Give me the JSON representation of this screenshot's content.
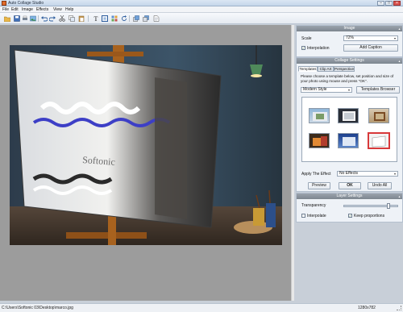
{
  "window": {
    "title": "Auto Collage Studio"
  },
  "menu": [
    "File",
    "Edit",
    "Image",
    "Effects",
    "View",
    "Help"
  ],
  "toolbar_icons": [
    "open-icon",
    "save-icon",
    "print-icon",
    "image-icon",
    "undo-icon",
    "redo-icon",
    "cut-icon",
    "copy-icon",
    "paste-icon",
    "text-icon",
    "border-icon",
    "collage-icon",
    "rotate-icon",
    "bring-forward-icon",
    "send-backward-icon",
    "page-icon"
  ],
  "status": {
    "path": "C:\\Users\\Softonic 03\\Desktop\\marco.jpg",
    "dimensions": "1280x782"
  },
  "image_panel": {
    "header": "Image",
    "scale_label": "Scale",
    "scale_value": "72%",
    "interpolation_label": "Interpolation",
    "interpolation_checked": true,
    "add_caption_label": "Add Caption"
  },
  "collage_panel": {
    "header": "Collage Settings",
    "tabs": [
      "Templates",
      "Clip Art",
      "Perspective"
    ],
    "instructions": "Please choose a template below, set position and size of your photo using mouse and press \"OK\".",
    "style_value": "Modern Style",
    "templates_browser_label": "Templates Browser",
    "apply_effect_label": "Apply The Effect",
    "effect_value": "No Effects",
    "preview_label": "Preview",
    "ok_label": "OK",
    "undo_all_label": "Undo All"
  },
  "layer_panel": {
    "header": "Layer Settings",
    "transparency_label": "Transparency",
    "transparency_level": 0.85,
    "interpolate_label": "Interpolate",
    "interpolate_checked": false,
    "keep_proportions_label": "Keep proportions",
    "keep_proportions_checked": true
  },
  "colors": {
    "panel_header": "#8a939c",
    "accent_selected": "#d8393a",
    "canvas_bg": "#9c9c9c"
  }
}
